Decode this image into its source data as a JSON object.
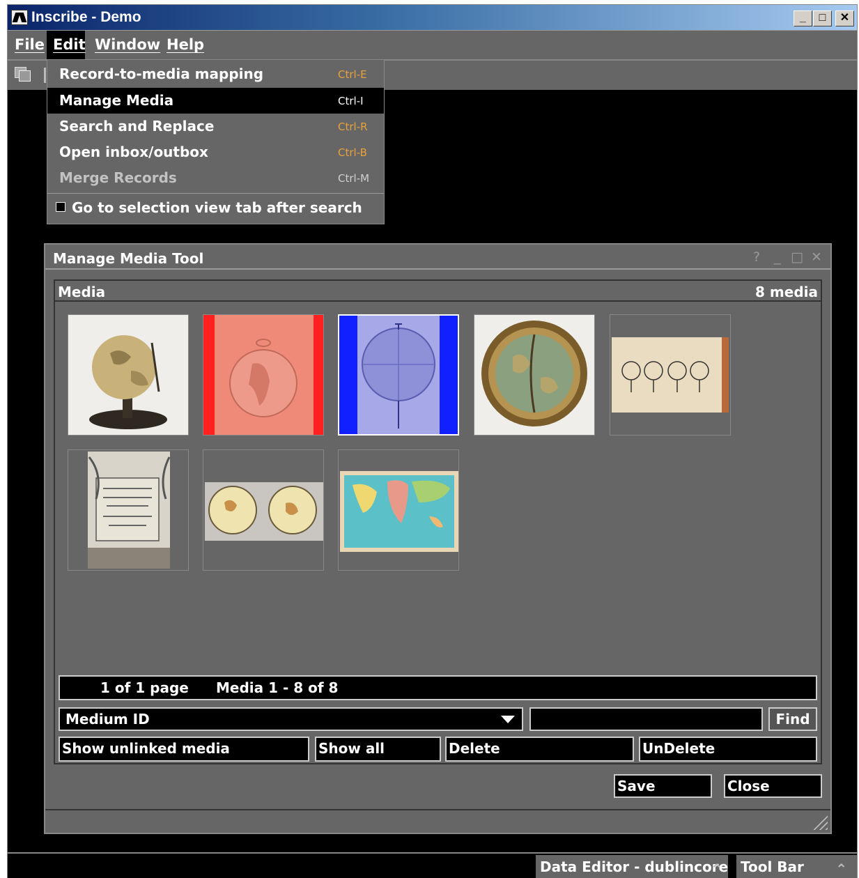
{
  "window": {
    "title": "Inscribe - Demo",
    "buttons": {
      "minimize": "_",
      "maximize": "□",
      "close": "✕"
    }
  },
  "menubar": {
    "items": [
      "File",
      "Edit",
      "Window",
      "Help"
    ],
    "active": "Edit"
  },
  "edit_menu": {
    "items": [
      {
        "label": "Record-to-media mapping",
        "shortcut": "Ctrl-E",
        "state": "normal"
      },
      {
        "label": "Manage Media",
        "shortcut": "Ctrl-I",
        "state": "highlighted"
      },
      {
        "label": "Search and Replace",
        "shortcut": "Ctrl-R",
        "state": "normal"
      },
      {
        "label": "Open inbox/outbox",
        "shortcut": "Ctrl-B",
        "state": "normal"
      },
      {
        "label": "Merge Records",
        "shortcut": "Ctrl-M",
        "state": "disabled"
      }
    ],
    "checkbox": {
      "label": "Go to selection view tab after search",
      "checked": false
    }
  },
  "manage_media": {
    "title": "Manage Media Tool",
    "controls": {
      "help": "?",
      "minimize": "_",
      "maximize": "□",
      "close": "✕"
    },
    "panel": {
      "title": "Media",
      "count": "8 media"
    },
    "thumbnails": [
      {
        "name": "globe-on-stand",
        "selected": false
      },
      {
        "name": "red-book-globe-page",
        "selected": false
      },
      {
        "name": "blue-globe-gores",
        "selected": false
      },
      {
        "name": "brass-armillary-globe",
        "selected": false
      },
      {
        "name": "open-book-globes",
        "selected": false
      },
      {
        "name": "title-page-engraving",
        "selected": false
      },
      {
        "name": "twin-hemisphere-map",
        "selected": false
      },
      {
        "name": "world-map-mercator",
        "selected": false
      }
    ],
    "pager": {
      "pages": "1 of 1 page",
      "range": "Media 1 - 8 of 8"
    },
    "search": {
      "field": "Medium ID",
      "value": "",
      "find_label": "Find"
    },
    "actions": {
      "show_unlinked": "Show unlinked media",
      "show_all": "Show all",
      "delete": "Delete",
      "undelete": "UnDelete"
    },
    "footer": {
      "save": "Save",
      "close": "Close"
    }
  },
  "taskbar": {
    "items": [
      {
        "label": "Data Editor - dublincore",
        "icon": "chevron-up-icon"
      },
      {
        "label": "Tool Bar",
        "icon": "chevron-up-icon"
      }
    ]
  }
}
